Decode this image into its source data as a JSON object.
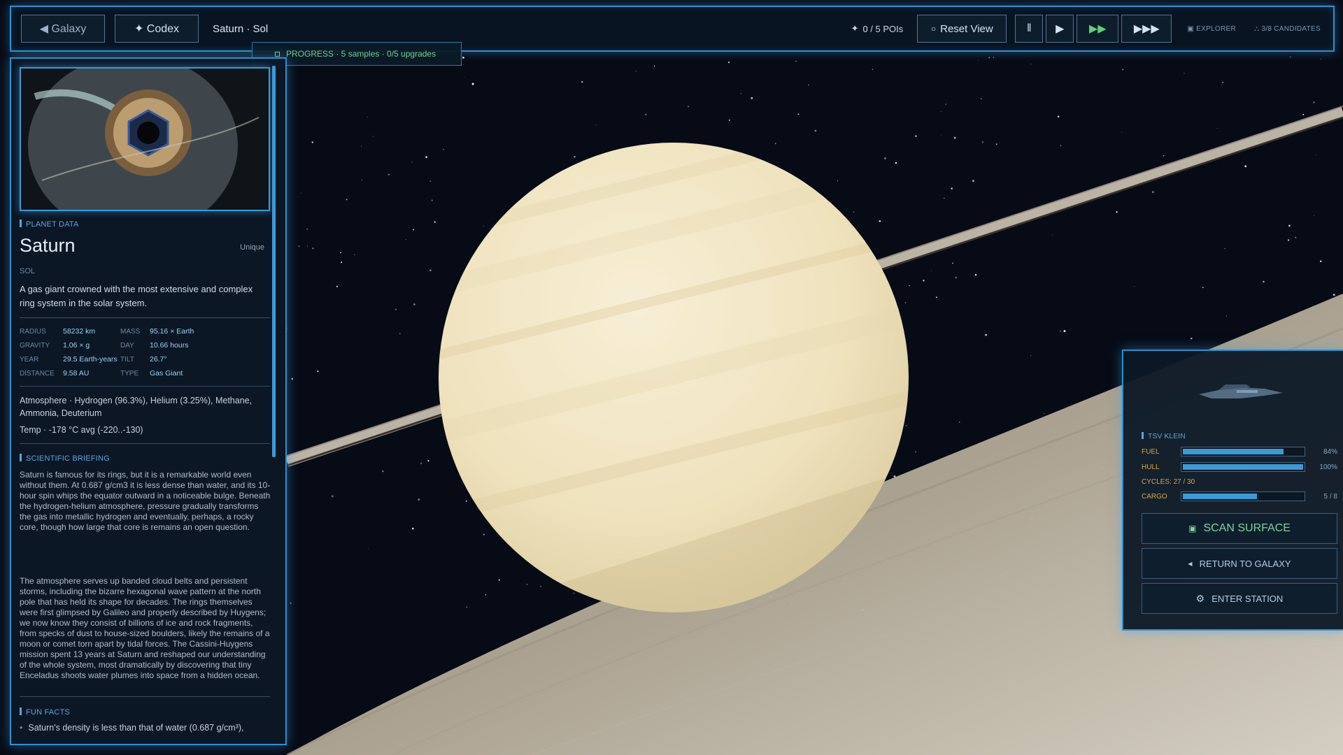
{
  "topbar": {
    "galaxy_label": "◀ Galaxy",
    "codex_label": "✦ Codex",
    "location": "Saturn · Sol",
    "pois": "0 / 5 POIs",
    "reset_label": "Reset View",
    "pause_label": "‖",
    "play_label": "▶",
    "fast_label": "▶▶",
    "faster_label": "▶▶▶",
    "mode_explorer": "EXPLORER",
    "candidates": "3/8 CANDIDATES"
  },
  "progress": {
    "text": "PROGRESS · 5 samples · 0/5 upgrades"
  },
  "planet": {
    "section_label": "PLANET DATA",
    "name": "Saturn",
    "rarity": "Unique",
    "system": "SOL",
    "description": "A gas giant crowned with the most extensive and complex ring system in the solar system.",
    "stats": [
      {
        "k1": "RADIUS",
        "v1": "58232 km",
        "k2": "MASS",
        "v2": "95.16 × Earth"
      },
      {
        "k1": "GRAVITY",
        "v1": "1.06 × g",
        "k2": "DAY",
        "v2": "10.66 hours"
      },
      {
        "k1": "YEAR",
        "v1": "29.5 Earth-years",
        "k2": "TILT",
        "v2": "26.7°"
      },
      {
        "k1": "DISTANCE",
        "v1": "9.58 AU",
        "k2": "TYPE",
        "v2": "Gas Giant"
      }
    ],
    "atmosphere": "Atmosphere · Hydrogen (96.3%), Helium (3.25%), Methane, Ammonia, Deuterium",
    "temperature": "Temp · -178 °C avg (-220..-130)"
  },
  "briefing": {
    "section_label": "SCIENTIFIC BRIEFING",
    "p1": "Saturn is famous for its rings, but it is a remarkable world even without them. At 0.687 g/cm3 it is less dense than water, and its 10-hour spin whips the equator outward in a noticeable bulge. Beneath the hydrogen-helium atmosphere, pressure gradually transforms the gas into metallic hydrogen and eventually, perhaps, a rocky core, though how large that core is remains an open question.",
    "p2": "The atmosphere serves up banded cloud belts and persistent storms, including the bizarre hexagonal wave pattern at the north pole that has held its shape for decades. The rings themselves were first glimpsed by Galileo and properly described by Huygens; we now know they consist of billions of ice and rock fragments, from specks of dust to house-sized boulders, likely the remains of a moon or comet torn apart by tidal forces. The Cassini-Huygens mission spent 13 years at Saturn and reshaped our understanding of the whole system, most dramatically by discovering that tiny Enceladus shoots water plumes into space from a hidden ocean."
  },
  "facts": {
    "section_label": "FUN FACTS",
    "first": "Saturn's density is less than that of water (0.687 g/cm³),"
  },
  "ship": {
    "name": "TSV KLEIN",
    "fuel_label": "FUEL",
    "fuel_value": "84%",
    "fuel_fraction": 0.84,
    "hull_label": "HULL",
    "hull_value": "100%",
    "hull_fraction": 1.0,
    "cycles": "CYCLES: 27 / 30",
    "cargo_label": "CARGO",
    "cargo_value": "5 / 8",
    "cargo_fraction": 0.625,
    "scan_label": "SCAN SURFACE",
    "return_label": "RETURN TO GALAXY",
    "station_label": "ENTER STATION"
  },
  "colors": {
    "accent": "#2f8fd0",
    "progress_green": "#6fd38f",
    "status_amber": "#d6a84a",
    "bar_blue": "#3a9ad8"
  }
}
